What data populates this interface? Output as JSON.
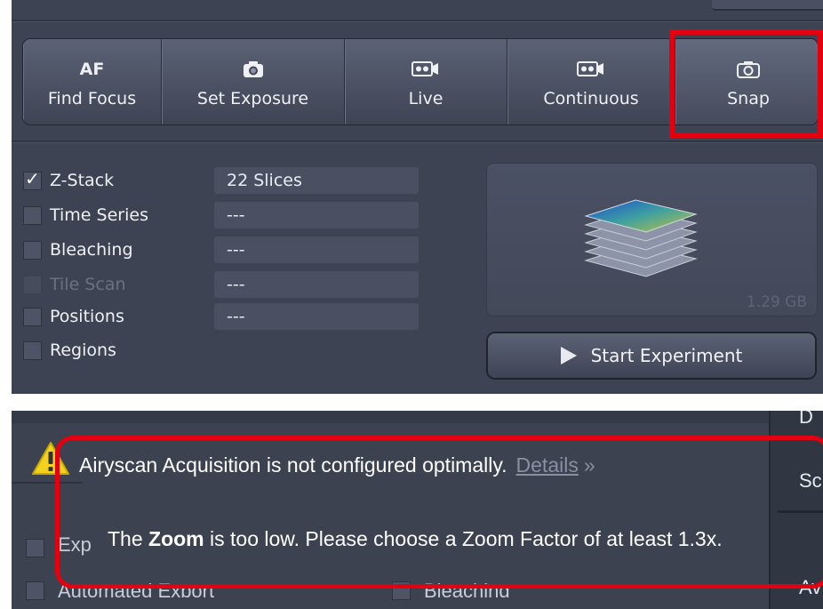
{
  "toolbar": {
    "buttons": [
      {
        "top": "AF",
        "label": "Find Focus",
        "icon": "af-text"
      },
      {
        "top": "",
        "label": "Set Exposure",
        "icon": "camera-icon"
      },
      {
        "top": "",
        "label": "Live",
        "icon": "video-camera-icon"
      },
      {
        "top": "",
        "label": "Continuous",
        "icon": "video-camera-icon"
      },
      {
        "top": "",
        "label": "Snap",
        "icon": "camera-outline-icon"
      }
    ]
  },
  "options": [
    {
      "label": "Z-Stack",
      "checked": true,
      "enabled": true,
      "value": "22 Slices"
    },
    {
      "label": "Time Series",
      "checked": false,
      "enabled": true,
      "value": "---"
    },
    {
      "label": "Bleaching",
      "checked": false,
      "enabled": true,
      "value": "---"
    },
    {
      "label": "Tile Scan",
      "checked": false,
      "enabled": false,
      "value": "---"
    },
    {
      "label": "Positions",
      "checked": false,
      "enabled": true,
      "value": "---"
    },
    {
      "label": "Regions",
      "checked": false,
      "enabled": true,
      "value": ""
    }
  ],
  "preview": {
    "size": "1.29 GB"
  },
  "start_button": {
    "label": "Start Experiment"
  },
  "warning": {
    "message": "Airyscan Acquisition is not configured optimally.",
    "details_link": "Details",
    "details_chevron": "»",
    "zoom_prefix": "The ",
    "zoom_bold": "Zoom",
    "zoom_suffix": " is too low. Please choose a Zoom Factor of at least 1.3x."
  },
  "background_items": {
    "export_label": "Exp",
    "automated_export_label": "Automated Export",
    "bleaching_label": "Bleaching",
    "right_top": "D",
    "right_mid": "Sc",
    "right_bottom": "Av"
  },
  "colors": {
    "panel_bg": "#3d4352",
    "highlight": "#e3000f",
    "warning_yellow": "#f2d21c"
  }
}
